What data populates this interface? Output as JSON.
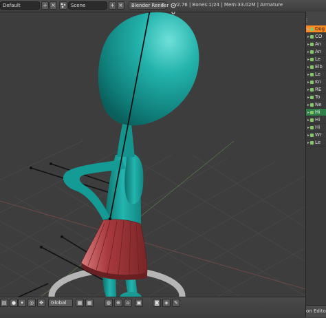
{
  "header": {
    "layout_name": "Default",
    "layout_add": "+",
    "layout_close": "×",
    "scene_name": "Scene",
    "scene_add": "+",
    "scene_close": "×",
    "renderer": "Blender Render",
    "stats": "v2.76 | Bones:1/24 | Mem:33.02M | Armature"
  },
  "outliner": {
    "rows": [
      {
        "label": "Dog",
        "state": "active"
      },
      {
        "label": "CO",
        "state": ""
      },
      {
        "label": "An",
        "state": ""
      },
      {
        "label": "An",
        "state": ""
      },
      {
        "label": "Le",
        "state": ""
      },
      {
        "label": "Elb",
        "state": ""
      },
      {
        "label": "Le",
        "state": ""
      },
      {
        "label": "Kn",
        "state": ""
      },
      {
        "label": "RE",
        "state": ""
      },
      {
        "label": "To",
        "state": ""
      },
      {
        "label": "Ne",
        "state": ""
      },
      {
        "label": "Hi",
        "state": "sel"
      },
      {
        "label": "Hi",
        "state": ""
      },
      {
        "label": "Hi",
        "state": ""
      },
      {
        "label": "Wr",
        "state": ""
      },
      {
        "label": "Le",
        "state": ""
      }
    ],
    "bottom_label": "on Editor"
  },
  "bottombar": {
    "orientation": "Global"
  },
  "colors": {
    "character": "#1fa8a2",
    "skirt": "#a83a3e",
    "header_bg": "#474747",
    "active_row": "#ff8a1f"
  }
}
